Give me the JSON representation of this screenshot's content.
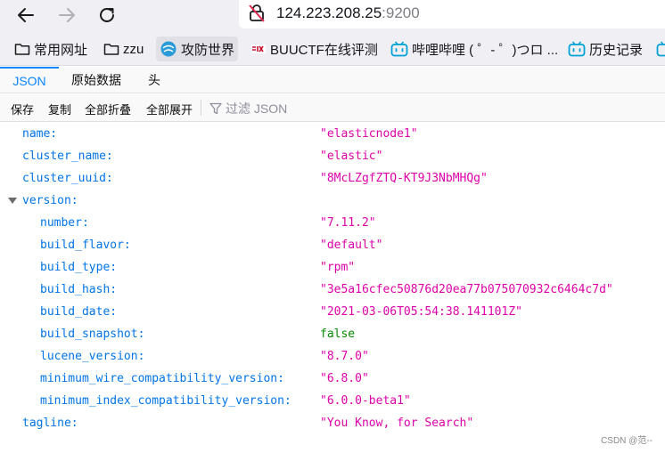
{
  "browser": {
    "url_host": "124.223.208.25",
    "url_port": ":9200"
  },
  "bookmarks": [
    {
      "label": "常用网址",
      "icon": "folder-icon"
    },
    {
      "label": "zzu",
      "icon": "folder-icon"
    },
    {
      "label": "攻防世界",
      "icon": "globe-icon"
    },
    {
      "label": "BUUCTF在线评测",
      "icon": "buuctf-logo-icon"
    },
    {
      "label": "哔哩哔哩 ( ゜- ゜)つロ ...",
      "icon": "bilibili-tv-icon"
    },
    {
      "label": "历史记录",
      "icon": "bilibili-tv-icon"
    }
  ],
  "viewer": {
    "tabs": [
      "JSON",
      "原始数据",
      "头"
    ],
    "selected_tab": "JSON",
    "toolbar": {
      "save": "保存",
      "copy": "复制",
      "collapse_all": "全部折叠",
      "expand_all": "全部展开",
      "filter_placeholder": "过滤 JSON"
    }
  },
  "json_rows": [
    {
      "key": "name:",
      "value": "\"elasticnode1\"",
      "type": "string",
      "level": 0
    },
    {
      "key": "cluster_name:",
      "value": "\"elastic\"",
      "type": "string",
      "level": 0
    },
    {
      "key": "cluster_uuid:",
      "value": "\"8McLZgfZTQ-KT9J3NbMHQg\"",
      "type": "string",
      "level": 0
    },
    {
      "key": "version:",
      "value": "",
      "type": "object",
      "level": 0
    },
    {
      "key": "number:",
      "value": "\"7.11.2\"",
      "type": "string",
      "level": 1
    },
    {
      "key": "build_flavor:",
      "value": "\"default\"",
      "type": "string",
      "level": 1
    },
    {
      "key": "build_type:",
      "value": "\"rpm\"",
      "type": "string",
      "level": 1
    },
    {
      "key": "build_hash:",
      "value": "\"3e5a16cfec50876d20ea77b075070932c6464c7d\"",
      "type": "string",
      "level": 1
    },
    {
      "key": "build_date:",
      "value": "\"2021-03-06T05:54:38.141101Z\"",
      "type": "string",
      "level": 1
    },
    {
      "key": "build_snapshot:",
      "value": "false",
      "type": "bool",
      "level": 1
    },
    {
      "key": "lucene_version:",
      "value": "\"8.7.0\"",
      "type": "string",
      "level": 1
    },
    {
      "key": "minimum_wire_compatibility_version:",
      "value": "\"6.8.0\"",
      "type": "string",
      "level": 1
    },
    {
      "key": "minimum_index_compatibility_version:",
      "value": "\"6.0.0-beta1\"",
      "type": "string",
      "level": 1
    },
    {
      "key": "tagline:",
      "value": "\"You Know, for Search\"",
      "type": "string",
      "level": 0
    }
  ],
  "colors": {
    "key": "#0074e8",
    "string": "#dd00a9",
    "bool": "#058b00",
    "accent": "#0a84ff"
  },
  "watermark": "CSDN @范--"
}
